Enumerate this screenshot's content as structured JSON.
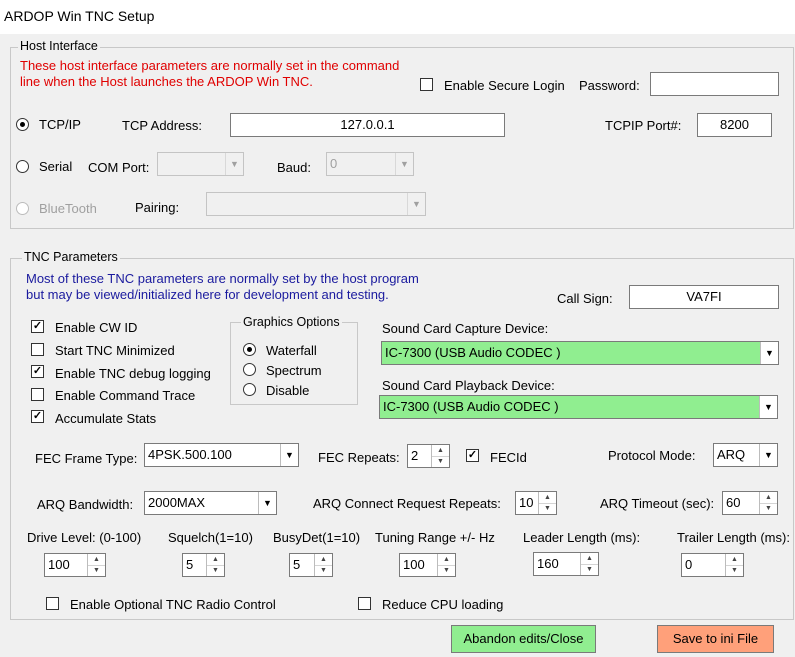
{
  "window": {
    "title": "ARDOP Win TNC Setup"
  },
  "host": {
    "group_label": "Host Interface",
    "note_line1": "These host interface parameters are normally set in the command",
    "note_line2": "line when the Host launches the ARDOP Win TNC.",
    "secure_login_label": "Enable Secure Login",
    "password_label": "Password:",
    "password_value": "",
    "tcpip_label": "TCP/IP",
    "tcp_address_label": "TCP Address:",
    "tcp_address_value": "127.0.0.1",
    "tcpip_port_label": "TCPIP Port#:",
    "tcpip_port_value": "8200",
    "serial_label": "Serial",
    "com_port_label": "COM Port:",
    "com_port_value": "",
    "baud_label": "Baud:",
    "baud_value": "0",
    "bluetooth_label": "BlueTooth",
    "pairing_label": "Pairing:",
    "pairing_value": ""
  },
  "tnc": {
    "group_label": "TNC Parameters",
    "note_line1": "Most of these TNC parameters are normally set by the host program",
    "note_line2": "but may be viewed/initialized here for development and testing.",
    "callsign_label": "Call Sign:",
    "callsign_value": "VA7FI",
    "checks": [
      {
        "label": "Enable CW ID",
        "checked": true
      },
      {
        "label": "Start TNC Minimized",
        "checked": false
      },
      {
        "label": "Enable TNC debug logging",
        "checked": true
      },
      {
        "label": "Enable Command Trace",
        "checked": false
      },
      {
        "label": "Accumulate Stats",
        "checked": true
      }
    ],
    "graphics": {
      "label": "Graphics Options",
      "options": [
        {
          "label": "Waterfall",
          "selected": true
        },
        {
          "label": "Spectrum",
          "selected": false
        },
        {
          "label": "Disable",
          "selected": false
        }
      ]
    },
    "capture_label": "Sound Card Capture Device:",
    "capture_value": "IC-7300 (USB Audio CODEC )",
    "playback_label": "Sound Card Playback Device:",
    "playback_value": "IC-7300 (USB Audio CODEC )",
    "fec_frame_label": "FEC Frame Type:",
    "fec_frame_value": "4PSK.500.100",
    "fec_repeats_label": "FEC Repeats:",
    "fec_repeats_value": "2",
    "fecid_label": "FECId",
    "fecid_checked": true,
    "protocol_label": "Protocol Mode:",
    "protocol_value": "ARQ",
    "arq_bw_label": "ARQ Bandwidth:",
    "arq_bw_value": "2000MAX",
    "arq_repeats_label": "ARQ Connect Request Repeats:",
    "arq_repeats_value": "10",
    "arq_timeout_label": "ARQ Timeout (sec):",
    "arq_timeout_value": "60",
    "drive_label": "Drive Level: (0-100)",
    "drive_value": "100",
    "squelch_label": "Squelch(1=10)",
    "squelch_value": "5",
    "busydet_label": "BusyDet(1=10)",
    "busydet_value": "5",
    "tuning_label": "Tuning Range +/- Hz",
    "tuning_value": "100",
    "leader_label": "Leader Length (ms):",
    "leader_value": "160",
    "trailer_label": "Trailer Length (ms):",
    "trailer_value": "0",
    "radio_control_label": "Enable Optional TNC Radio Control",
    "cpu_label": "Reduce CPU loading"
  },
  "buttons": {
    "abandon_label": "Abandon edits/Close",
    "abandon_color": "#90ee90",
    "save_label": "Save to ini File",
    "save_color": "#ffa07a"
  }
}
